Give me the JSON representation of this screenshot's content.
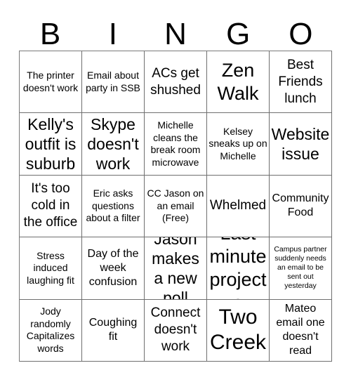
{
  "header": {
    "letters": [
      "B",
      "I",
      "N",
      "G",
      "O"
    ]
  },
  "grid": {
    "columns": 5,
    "rows": 5,
    "cells": [
      {
        "text": "The printer doesn't work",
        "size": "s"
      },
      {
        "text": "Email about party in SSB",
        "size": "s"
      },
      {
        "text": "ACs get shushed",
        "size": "l"
      },
      {
        "text": "Zen Walk",
        "size": "xxl"
      },
      {
        "text": "Best Friends lunch",
        "size": "l"
      },
      {
        "text": "Kelly's outfit is suburb",
        "size": "xl"
      },
      {
        "text": "Skype doesn't work",
        "size": "xl"
      },
      {
        "text": "Michelle cleans the break room microwave",
        "size": "s"
      },
      {
        "text": "Kelsey sneaks up on Michelle",
        "size": "s"
      },
      {
        "text": "Website issue",
        "size": "xl"
      },
      {
        "text": "It's too cold in the office",
        "size": "l"
      },
      {
        "text": "Eric asks questions about a filter",
        "size": "s"
      },
      {
        "text": "CC Jason on an email (Free)",
        "size": "s"
      },
      {
        "text": "Whelmed",
        "size": "l"
      },
      {
        "text": "Community Food",
        "size": "m"
      },
      {
        "text": "Stress induced laughing fit",
        "size": "s"
      },
      {
        "text": "Day of the week confusion",
        "size": "m"
      },
      {
        "text": "Jason makes a new poll",
        "size": "xl"
      },
      {
        "text": "Last minute projects",
        "size": "xxl"
      },
      {
        "text": "Campus partner suddenly needs an email to be sent out yesterday",
        "size": "xs"
      },
      {
        "text": "Jody randomly Capitalizes words",
        "size": "s"
      },
      {
        "text": "Coughing fit",
        "size": "m"
      },
      {
        "text": "Connect doesn't work",
        "size": "l"
      },
      {
        "text": "Two Creek",
        "size": "xxxl"
      },
      {
        "text": "Mateo email one doesn't read",
        "size": "m"
      }
    ]
  },
  "colors": {
    "background": "#ffffff",
    "text": "#000000",
    "grid_line": "#6f6f6f"
  }
}
